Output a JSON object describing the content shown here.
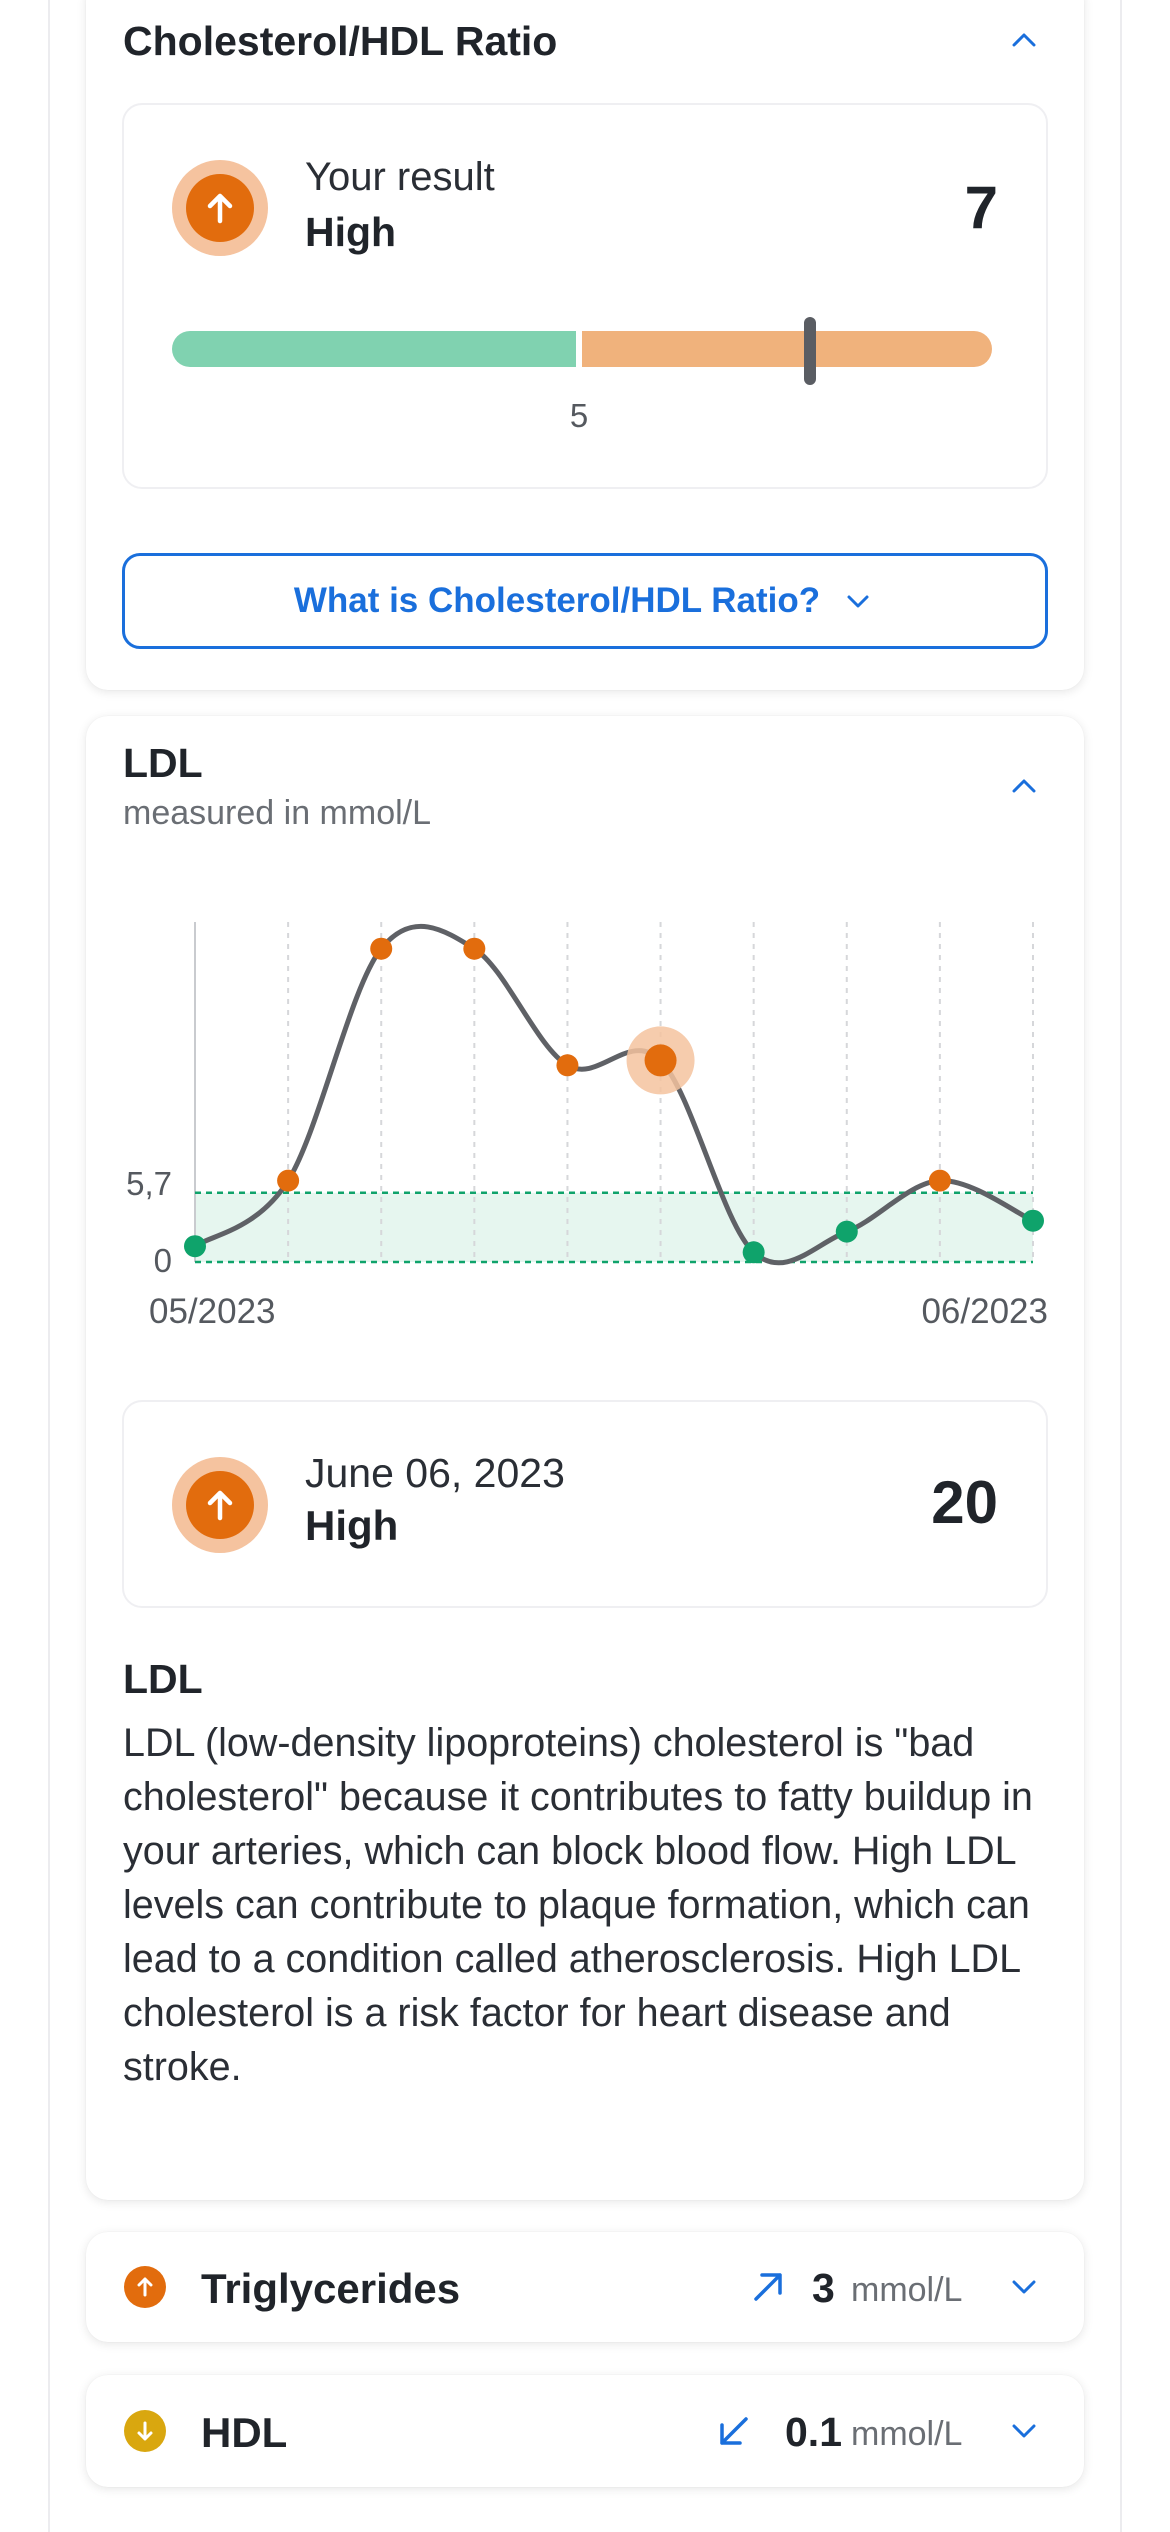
{
  "ratio": {
    "title": "Cholesterol/HDL Ratio",
    "result_label": "Your result",
    "status": "High",
    "value": "7",
    "threshold_label": "5",
    "marker_value": 7,
    "range_max": 9,
    "info_button": "What is Cholesterol/HDL Ratio?",
    "status_color": "#e26c0d"
  },
  "ldl": {
    "title": "LDL",
    "subtitle": "measured in mmol/L",
    "selected": {
      "date": "June 06, 2023",
      "status": "High",
      "value": "20"
    },
    "description_title": "LDL",
    "description": "LDL (low-density lipoproteins) cholesterol is \"bad cholesterol\" because it contributes to fatty buildup in your arteries, which can block blood flow. High LDL levels can contribute to plaque formation, which can lead to a condition called atherosclerosis. High LDL cholesterol is a risk factor for heart disease and stroke."
  },
  "chart_data": {
    "type": "line",
    "x_labels": [
      "05/2023",
      "06/2023"
    ],
    "y_tick_labels": [
      "0",
      "5,7"
    ],
    "reference_range": [
      0,
      5.7
    ],
    "ylim": [
      0,
      28
    ],
    "values": [
      1.3,
      6.7,
      25.8,
      25.8,
      16.2,
      16.6,
      0.8,
      2.5,
      6.7,
      3.4
    ],
    "point_status": [
      "normal",
      "high",
      "high",
      "high",
      "high",
      "high",
      "normal",
      "normal",
      "high",
      "normal"
    ],
    "selected_index": 5,
    "colors": {
      "high": "#e26c0d",
      "normal": "#0fa36b",
      "line": "#5f6166",
      "range_fill": "#e6f6ef",
      "range_stroke": "#0fa36b"
    }
  },
  "rows": [
    {
      "name": "Triglycerides",
      "trend": "up-right-arrow-icon",
      "value": "3",
      "unit": "mmol/L",
      "status": "high",
      "badge_color": "#e26c0d"
    },
    {
      "name": "HDL",
      "trend": "down-left-arrow-icon",
      "value": "0.1",
      "unit": "mmol/L",
      "status": "low",
      "badge_color": "#d9a70f"
    }
  ]
}
